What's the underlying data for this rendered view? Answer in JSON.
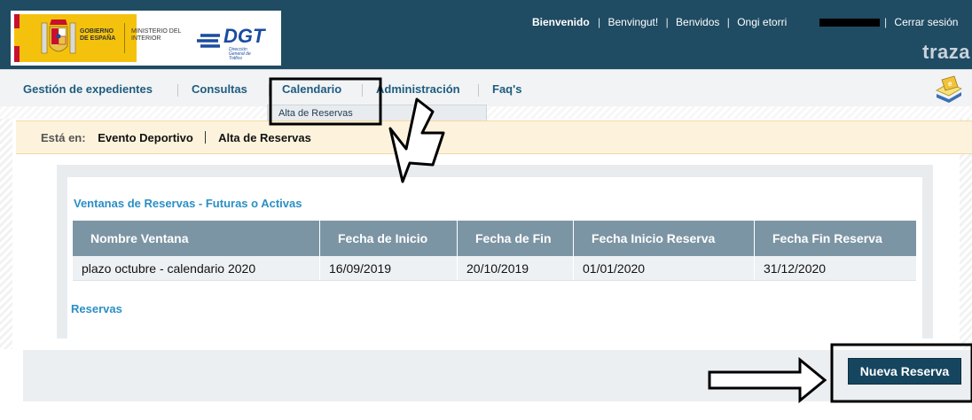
{
  "header": {
    "logo": {
      "gobierno": "GOBIERNO DE ESPAÑA",
      "ministerio": "MINISTERIO DEL INTERIOR",
      "dgt": "DGT",
      "dgt_sub": "Dirección General de Tráfico"
    },
    "welcome": "Bienvenido",
    "languages": [
      "Benvingut!",
      "Benvidos",
      "Ongi etorri"
    ],
    "logout": "Cerrar sesión",
    "brand": "traza"
  },
  "nav": {
    "items": [
      "Gestión de expedientes",
      "Consultas",
      "Calendario",
      "Administración",
      "Faq's"
    ],
    "dropdown_item": "Alta de Reservas"
  },
  "breadcrumb": {
    "label": "Está en:",
    "items": [
      "Evento Deportivo",
      "Alta de Reservas"
    ]
  },
  "section_windows": "Ventanas de Reservas - Futuras o Activas",
  "table": {
    "headers": [
      "Nombre Ventana",
      "Fecha de Inicio",
      "Fecha de Fin",
      "Fecha Inicio Reserva",
      "Fecha Fin Reserva"
    ],
    "rows": [
      [
        "plazo octubre - calendario 2020",
        "16/09/2019",
        "20/10/2019",
        "01/01/2020",
        "31/12/2020"
      ]
    ]
  },
  "section_reservas": "Reservas",
  "button_nueva_reserva": "Nueva Reserva",
  "colors": {
    "header_bg": "#1f4b63",
    "nav_text": "#1f5c7e",
    "section_title": "#2a8fc5",
    "table_header": "#7c95a4",
    "button_bg": "#16465f"
  }
}
